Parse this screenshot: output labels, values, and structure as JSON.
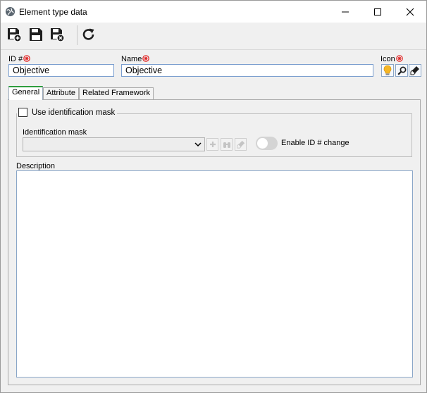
{
  "window": {
    "title": "Element type data",
    "controls": {
      "minimize": "minimize",
      "maximize": "maximize",
      "close": "close"
    }
  },
  "toolbar": {
    "buttons": [
      {
        "name": "save-and-new",
        "icon": "floppy-plus-icon"
      },
      {
        "name": "save",
        "icon": "floppy-icon"
      },
      {
        "name": "save-and-close",
        "icon": "floppy-close-icon"
      },
      {
        "name": "refresh",
        "icon": "refresh-icon"
      }
    ]
  },
  "form": {
    "id_label": "ID #",
    "id_value": "Objective",
    "name_label": "Name",
    "name_value": "Objective",
    "icon_label": "Icon",
    "icon_buttons": [
      "lightbulb-icon",
      "search-icon",
      "eraser-icon"
    ]
  },
  "tabs": [
    {
      "label": "General",
      "active": true
    },
    {
      "label": "Attribute",
      "active": false
    },
    {
      "label": "Related Framework",
      "active": false
    }
  ],
  "general": {
    "use_mask_label": "Use identification mask",
    "use_mask_checked": false,
    "mask_label": "Identification mask",
    "mask_value": "",
    "enable_id_change_label": "Enable ID # change",
    "enable_id_change_on": false,
    "description_label": "Description",
    "description_value": ""
  },
  "colors": {
    "required_marker": "#e02020",
    "active_tab_accent": "#2e9d3e",
    "field_border": "#7a9ecf"
  }
}
